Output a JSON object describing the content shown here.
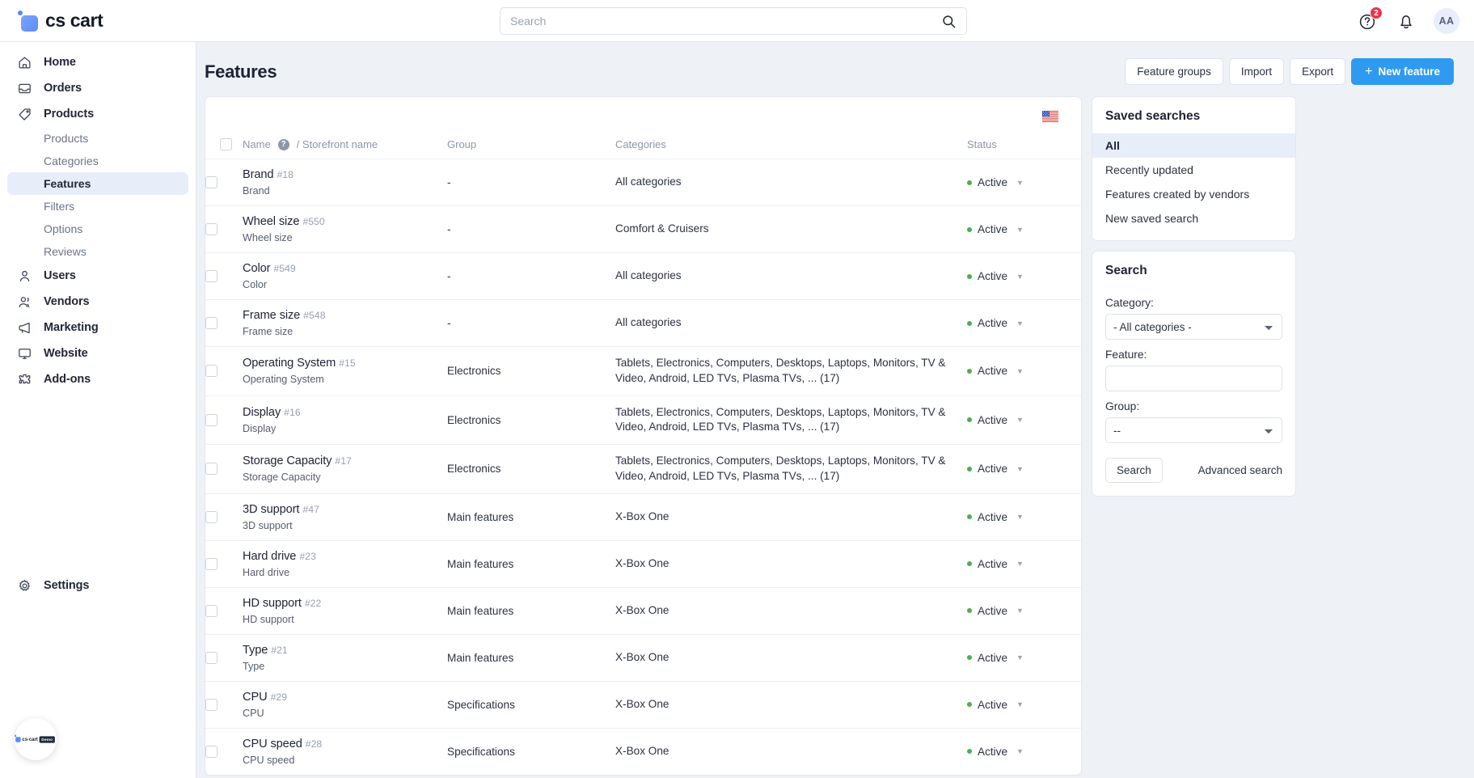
{
  "brand": {
    "name": "cs cart"
  },
  "topbar": {
    "search_placeholder": "Search",
    "search_value": "",
    "help_badge": "2",
    "avatar_initials": "AA"
  },
  "sidebar": {
    "items": [
      {
        "label": "Home",
        "icon": "home-icon"
      },
      {
        "label": "Orders",
        "icon": "inbox-icon"
      },
      {
        "label": "Products",
        "icon": "tag-icon"
      }
    ],
    "product_subitems": [
      {
        "label": "Products",
        "active": false
      },
      {
        "label": "Categories",
        "active": false
      },
      {
        "label": "Features",
        "active": true
      },
      {
        "label": "Filters",
        "active": false
      },
      {
        "label": "Options",
        "active": false
      },
      {
        "label": "Reviews",
        "active": false
      }
    ],
    "items2": [
      {
        "label": "Users",
        "icon": "user-icon"
      },
      {
        "label": "Vendors",
        "icon": "users-icon"
      },
      {
        "label": "Marketing",
        "icon": "megaphone-icon"
      },
      {
        "label": "Website",
        "icon": "monitor-icon"
      },
      {
        "label": "Add-ons",
        "icon": "puzzle-icon"
      }
    ],
    "settings": {
      "label": "Settings",
      "icon": "gear-icon"
    },
    "demo_badge": {
      "name": "cs·cart",
      "tag": "Demo"
    }
  },
  "header": {
    "title": "Features",
    "buttons": [
      {
        "label": "Feature groups",
        "primary": false
      },
      {
        "label": "Import",
        "primary": false
      },
      {
        "label": "Export",
        "primary": false
      }
    ],
    "new_feature_label": "New feature",
    "new_feature_plus": "+"
  },
  "table": {
    "language_flag": "us-flag-icon",
    "columns": {
      "name": "Name",
      "storefront": "/ Storefront name",
      "group": "Group",
      "categories": "Categories",
      "status": "Status"
    },
    "rows": [
      {
        "name": "Brand",
        "id": "#18",
        "storefront": "Brand",
        "group": "-",
        "categories": "All categories",
        "status": "Active"
      },
      {
        "name": "Wheel size",
        "id": "#550",
        "storefront": "Wheel size",
        "group": "-",
        "categories": "Comfort & Cruisers",
        "status": "Active"
      },
      {
        "name": "Color",
        "id": "#549",
        "storefront": "Color",
        "group": "-",
        "categories": "All categories",
        "status": "Active"
      },
      {
        "name": "Frame size",
        "id": "#548",
        "storefront": "Frame size",
        "group": "-",
        "categories": "All categories",
        "status": "Active"
      },
      {
        "name": "Operating System",
        "id": "#15",
        "storefront": "Operating System",
        "group": "Electronics",
        "categories": "Tablets, Electronics, Computers, Desktops, Laptops, Monitors, TV & Video, Android, LED TVs, Plasma TVs, ... (17)",
        "status": "Active"
      },
      {
        "name": "Display",
        "id": "#16",
        "storefront": "Display",
        "group": "Electronics",
        "categories": "Tablets, Electronics, Computers, Desktops, Laptops, Monitors, TV & Video, Android, LED TVs, Plasma TVs, ... (17)",
        "status": "Active"
      },
      {
        "name": "Storage Capacity",
        "id": "#17",
        "storefront": "Storage Capacity",
        "group": "Electronics",
        "categories": "Tablets, Electronics, Computers, Desktops, Laptops, Monitors, TV & Video, Android, LED TVs, Plasma TVs, ... (17)",
        "status": "Active"
      },
      {
        "name": "3D support",
        "id": "#47",
        "storefront": "3D support",
        "group": "Main features",
        "categories": "X-Box One",
        "status": "Active"
      },
      {
        "name": "Hard drive",
        "id": "#23",
        "storefront": "Hard drive",
        "group": "Main features",
        "categories": "X-Box One",
        "status": "Active"
      },
      {
        "name": "HD support",
        "id": "#22",
        "storefront": "HD support",
        "group": "Main features",
        "categories": "X-Box One",
        "status": "Active"
      },
      {
        "name": "Type",
        "id": "#21",
        "storefront": "Type",
        "group": "Main features",
        "categories": "X-Box One",
        "status": "Active"
      },
      {
        "name": "CPU",
        "id": "#29",
        "storefront": "CPU",
        "group": "Specifications",
        "categories": "X-Box One",
        "status": "Active"
      },
      {
        "name": "CPU speed",
        "id": "#28",
        "storefront": "CPU speed",
        "group": "Specifications",
        "categories": "X-Box One",
        "status": "Active"
      }
    ]
  },
  "saved_searches": {
    "title": "Saved searches",
    "items": [
      {
        "label": "All",
        "active": true
      },
      {
        "label": "Recently updated",
        "active": false
      },
      {
        "label": "Features created by vendors",
        "active": false
      },
      {
        "label": "New saved search",
        "active": false
      }
    ]
  },
  "search_panel": {
    "title": "Search",
    "category_label": "Category:",
    "category_value": "- All categories -",
    "feature_label": "Feature:",
    "feature_value": "",
    "group_label": "Group:",
    "group_value": "--",
    "search_button": "Search",
    "advanced_link": "Advanced search"
  },
  "colors": {
    "accent": "#2e9bf0",
    "active_status": "#4caf50",
    "badge_red": "#e8344a",
    "sidebar_active_bg": "#e7eef9"
  }
}
